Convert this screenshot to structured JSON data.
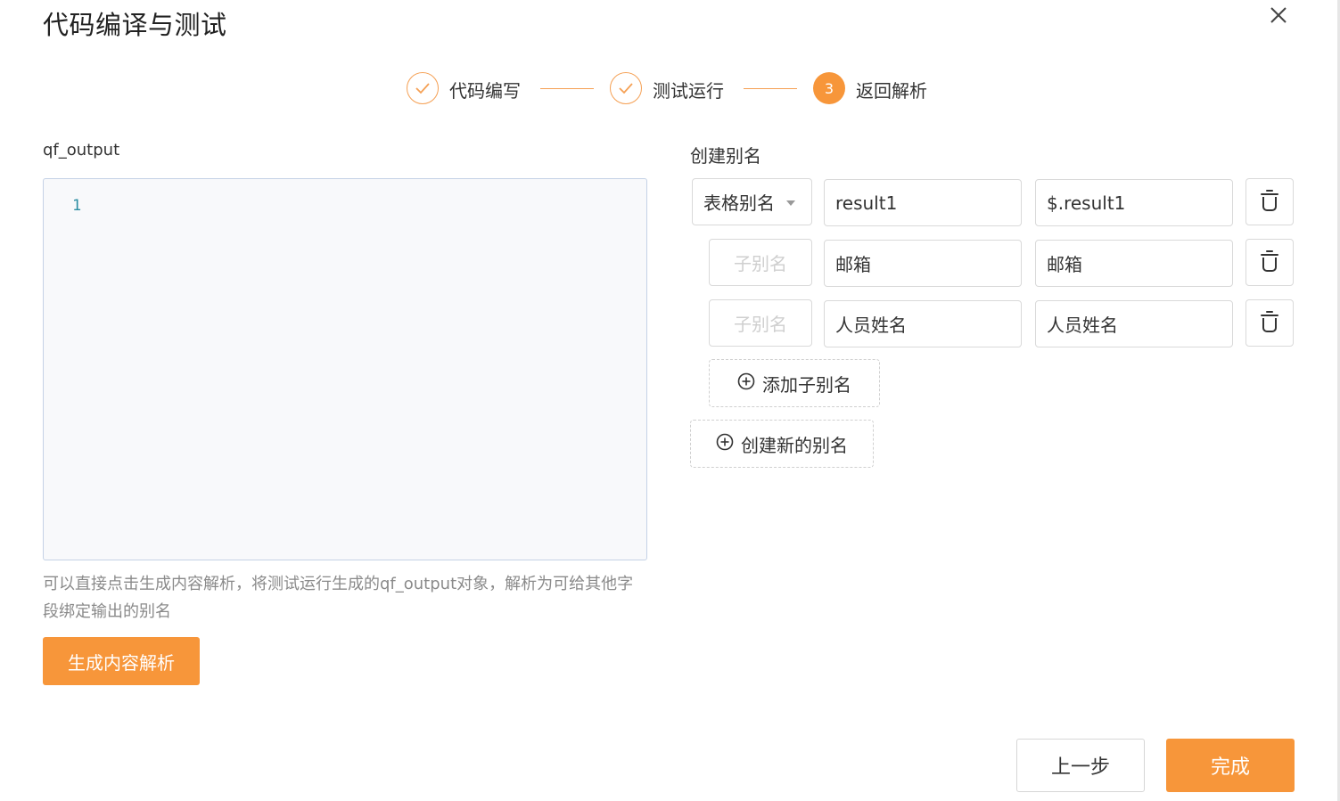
{
  "dialog": {
    "title": "代码编译与测试"
  },
  "steps": [
    {
      "label": "代码编写",
      "status": "done"
    },
    {
      "label": "测试运行",
      "status": "done"
    },
    {
      "label": "返回解析",
      "status": "active",
      "number": "3"
    }
  ],
  "editor": {
    "label": "qf_output",
    "line_number": "1",
    "content": ""
  },
  "hint": "可以直接点击生成内容解析，将测试运行生成的qf_output对象，解析为可给其他字段绑定输出的别名",
  "generate_button": "生成内容解析",
  "alias": {
    "section_label": "创建别名",
    "main_row": {
      "type_select": "表格别名",
      "name": "result1",
      "path": "$.result1"
    },
    "sub_rows": [
      {
        "placeholder": "子别名",
        "name": "邮箱",
        "path": "邮箱"
      },
      {
        "placeholder": "子别名",
        "name": "人员姓名",
        "path": "人员姓名"
      }
    ],
    "add_sub_label": "添加子别名",
    "create_new_label": "创建新的别名"
  },
  "footer": {
    "prev_label": "上一步",
    "finish_label": "完成"
  },
  "colors": {
    "accent": "#f7963a",
    "editor_border": "#c5d2e6",
    "editor_bg": "#f8f9fb"
  }
}
